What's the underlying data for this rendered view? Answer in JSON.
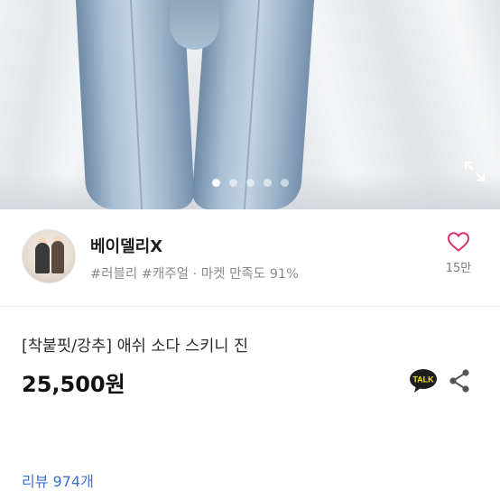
{
  "gallery": {
    "image": "jeans-product-photo",
    "dot_count": 5,
    "active_dot": 1,
    "expand_icon": "expand-arrows-icon"
  },
  "seller": {
    "name": "베이델리X",
    "tags": "#러블리 #캐주얼 · 마켓 만족도 91%",
    "avatar": "seller-avatar"
  },
  "like": {
    "icon": "heart-outline-icon",
    "color": "#e0306a",
    "count": "15만"
  },
  "product": {
    "title": "[착붙핏/강추] 애쉬 소다 스키니 진",
    "price": "25,500원"
  },
  "actions": {
    "talk_label": "TALK",
    "talk_icon": "kakaotalk-icon",
    "talk_color": "#1e1e1e",
    "talk_bg": "#f9e000",
    "share_icon": "share-icon"
  },
  "review": {
    "label": "리뷰 974개",
    "color": "#3d6fd8"
  }
}
